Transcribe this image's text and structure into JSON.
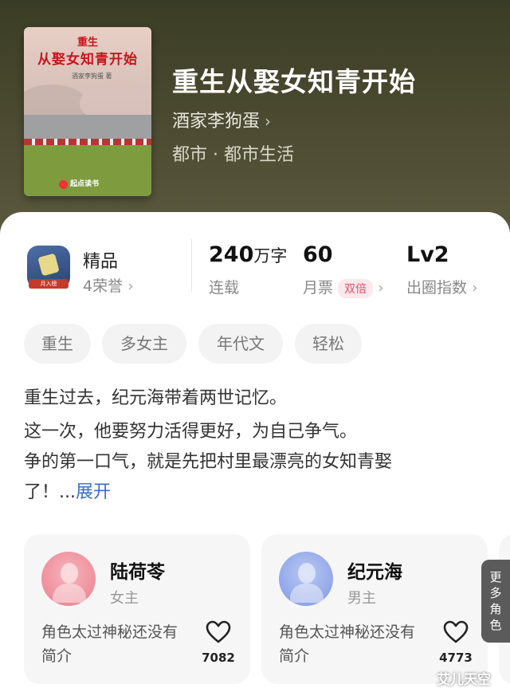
{
  "book": {
    "cover": {
      "title_small": "重生",
      "title_big": "从娶女知青开始",
      "author_small": "酒家李狗蛋 著",
      "publisher": "起点读书"
    },
    "title": "重生从娶女知青开始",
    "author": "酒家李狗蛋",
    "genre": "都市 · 都市生活"
  },
  "stats": {
    "badge_ribbon": "月入榜",
    "quality": {
      "label": "精品",
      "honors": "4荣誉"
    },
    "words": {
      "value": "240",
      "unit": "万字",
      "status": "连载"
    },
    "tickets": {
      "value": "60",
      "label": "月票",
      "badge": "双倍"
    },
    "index": {
      "value": "Lv2",
      "label": "出圈指数"
    }
  },
  "tags": [
    "重生",
    "多女主",
    "年代文",
    "轻松"
  ],
  "description": {
    "lines": [
      "重生过去，纪元海带着两世记忆。",
      "这一次，他要努力活得更好，为自己争气。",
      "争的第一口气，就是先把村里最漂亮的女知青娶",
      "了！..."
    ],
    "expand": "展开"
  },
  "roles": [
    {
      "name": "陆荷苓",
      "role": "女主",
      "desc": "角色太过神秘还没有简介",
      "likes": "7082",
      "avatar_color": "#ef9aa5"
    },
    {
      "name": "纪元海",
      "role": "男主",
      "desc": "角色太过神秘还没有简介",
      "likes": "4773",
      "avatar_color": "#9bb0ee"
    }
  ],
  "more_roles": "更多角色",
  "watermark": "艾儿天空",
  "icons": {
    "chevron": "chevron-right-icon",
    "heart": "heart-icon"
  }
}
